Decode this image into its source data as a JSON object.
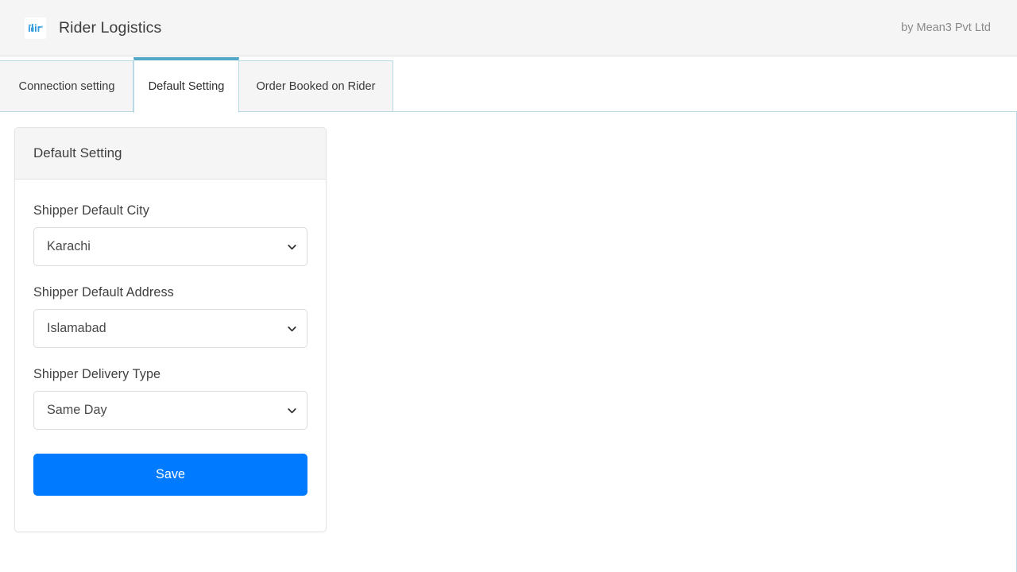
{
  "header": {
    "brand_title": "Rider Logistics",
    "logo_icon": "rider-wordmark-logo",
    "credit": "by Mean3 Pvt Ltd"
  },
  "tabs": [
    {
      "label": "Connection setting",
      "active": false
    },
    {
      "label": "Default Setting",
      "active": true
    },
    {
      "label": "Order Booked on Rider",
      "active": false
    }
  ],
  "card": {
    "title": "Default Setting",
    "fields": [
      {
        "label": "Shipper Default City",
        "value": "Karachi",
        "chevron_icon": "chevron-down-icon"
      },
      {
        "label": "Shipper Default Address",
        "value": "Islamabad",
        "chevron_icon": "chevron-down-icon"
      },
      {
        "label": "Shipper Delivery Type",
        "value": "Same Day",
        "chevron_icon": "chevron-down-icon"
      }
    ],
    "save_label": "Save"
  },
  "colors": {
    "primary": "#007bff",
    "tab_accent": "#52a8c6",
    "tab_border": "#b8d9e6",
    "header_bg": "#f5f5f5",
    "muted_text": "#8a8a8a"
  }
}
